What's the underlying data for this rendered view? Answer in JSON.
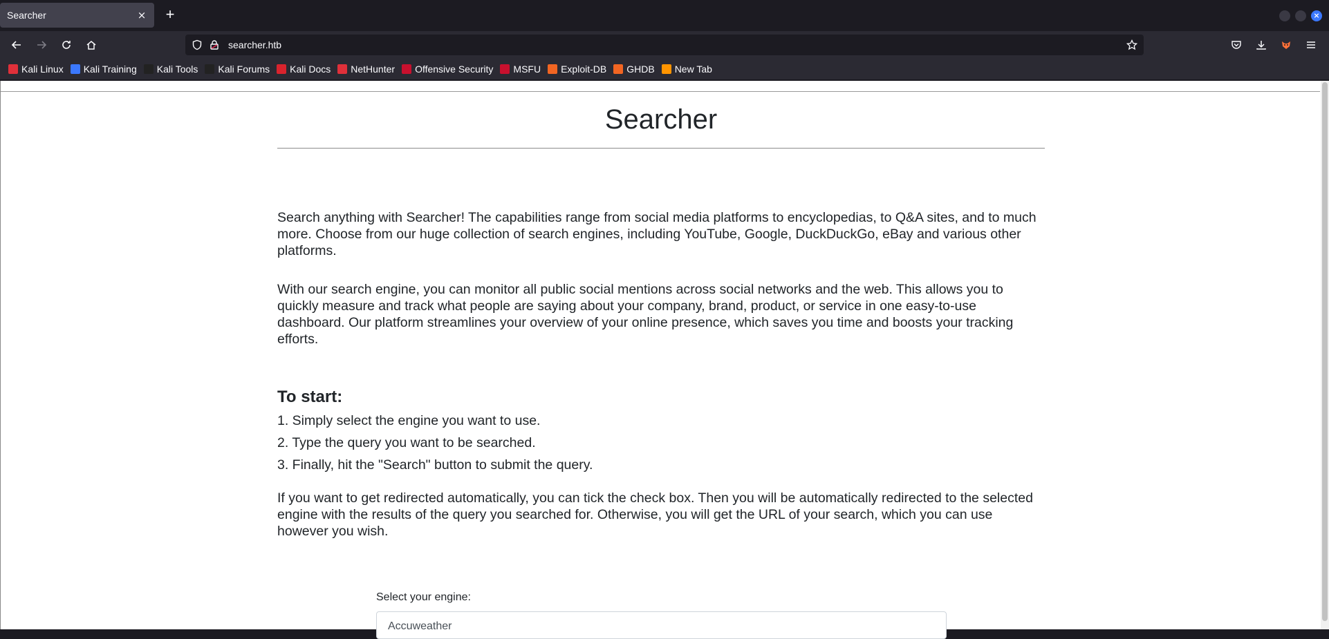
{
  "browser": {
    "tab_title": "Searcher",
    "tab_close": "×",
    "new_tab": "+",
    "url": "searcher.htb",
    "window_close": "×"
  },
  "bookmarks": [
    {
      "label": "Kali Linux",
      "color": "#e0303a"
    },
    {
      "label": "Kali Training",
      "color": "#3b78ff"
    },
    {
      "label": "Kali Tools",
      "color": "#222222"
    },
    {
      "label": "Kali Forums",
      "color": "#222222"
    },
    {
      "label": "Kali Docs",
      "color": "#d9232d"
    },
    {
      "label": "NetHunter",
      "color": "#e0303a"
    },
    {
      "label": "Offensive Security",
      "color": "#c8102e"
    },
    {
      "label": "MSFU",
      "color": "#c8102e"
    },
    {
      "label": "Exploit-DB",
      "color": "#f26522"
    },
    {
      "label": "GHDB",
      "color": "#f26522"
    },
    {
      "label": "New Tab",
      "color": "#ff9400"
    }
  ],
  "page": {
    "title": "Searcher",
    "intro": "Search anything with Searcher! The capabilities range from social media platforms to encyclopedias, to Q&A sites, and to much more. Choose from our huge collection of search engines, including YouTube, Google, DuckDuckGo, eBay and various other platforms.",
    "monitor": "With our search engine, you can monitor all public social mentions across social networks and the web. This allows you to quickly measure and track what people are saying about your company, brand, product, or service in one easy-to-use dashboard. Our platform streamlines your overview of your online presence, which saves you time and boosts your tracking efforts.",
    "start_heading": "To start:",
    "steps": [
      "1. Simply select the engine you want to use.",
      "2. Type the query you want to be searched.",
      "3. Finally, hit the \"Search\" button to submit the query."
    ],
    "redirect": "If you want to get redirected automatically, you can tick the check box. Then you will be automatically redirected to the selected engine with the results of the query you searched for. Otherwise, you will get the URL of your search, which you can use however you wish.",
    "engine_label": "Select your engine:",
    "engine_selected": "Accuweather"
  }
}
